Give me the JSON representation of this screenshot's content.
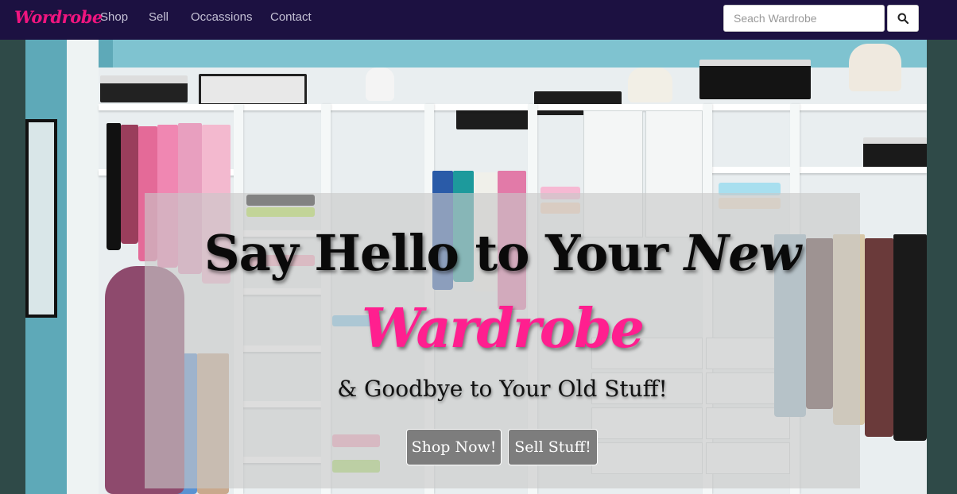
{
  "navbar": {
    "brand": "Wordrobe",
    "links": [
      "Shop",
      "Sell",
      "Occassions",
      "Contact"
    ],
    "search": {
      "placeholder": "Seach Wardrobe",
      "value": ""
    },
    "search_icon": "search-icon"
  },
  "hero": {
    "line1_prefix": "Say Hello to Your ",
    "line1_emphasis": "New",
    "brand": "Wardrobe",
    "line2": "& Goodbye to Your Old Stuff!",
    "buttons": {
      "shop": "Shop Now!",
      "sell": "Sell Stuff!"
    }
  },
  "colors": {
    "navbar_bg": "#1c1141",
    "brand_pink": "#f0157f",
    "hero_brand_pink": "#ff1f8f",
    "page_bg": "#2f4a48",
    "button_bg": "#7d7d7d"
  }
}
